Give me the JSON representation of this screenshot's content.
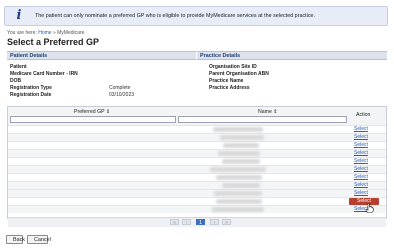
{
  "banner": {
    "text": "The patient can only nominate a preferred GP who is eligible to provide MyMedicare services at the selected practice."
  },
  "breadcrumb": {
    "prefix": "You are here:",
    "home": "Home",
    "separator": "»",
    "current": "MyMedicare"
  },
  "page_title": "Select a Preferred GP",
  "patient_details": {
    "heading": "Patient Details",
    "fields": [
      {
        "label": "Patient",
        "value": ""
      },
      {
        "label": "Medicare Card Number - IRN",
        "value": ""
      },
      {
        "label": "DOB",
        "value": ""
      },
      {
        "label": "Registration Type",
        "value": "Complete"
      },
      {
        "label": "Registration Date",
        "value": "03/10/2023"
      }
    ]
  },
  "practice_details": {
    "heading": "Practice Details",
    "fields": [
      {
        "label": "Organisation Site ID",
        "value": ""
      },
      {
        "label": "Parent Organisation ABN",
        "value": ""
      },
      {
        "label": "Practice Name",
        "value": ""
      },
      {
        "label": "Practice Address",
        "value": ""
      }
    ]
  },
  "grid": {
    "columns": {
      "preferred_gp": "Preferred GP ⇕",
      "name": "Name ⇕",
      "action": "Action"
    },
    "select_label": "Select",
    "selected_row_index": 8,
    "pager": {
      "first": "«",
      "prev": "‹",
      "current": "1",
      "next": "›",
      "last": "»"
    }
  },
  "buttons": {
    "back": "Back",
    "cancel": "Cancel"
  }
}
